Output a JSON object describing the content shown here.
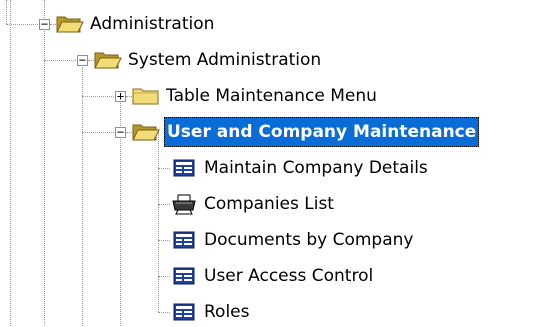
{
  "tree": {
    "nodes": [
      {
        "id": "administration",
        "label": "Administration",
        "depth": 0,
        "icon": "folder-open-icon",
        "expander": "minus",
        "selected": false
      },
      {
        "id": "system-administration",
        "label": "System Administration",
        "depth": 1,
        "icon": "folder-open-icon",
        "expander": "minus",
        "selected": false
      },
      {
        "id": "table-maintenance-menu",
        "label": "Table Maintenance Menu",
        "depth": 2,
        "icon": "folder-closed-icon",
        "expander": "plus",
        "selected": false
      },
      {
        "id": "user-and-company-maintenance",
        "label": "User and Company Maintenance",
        "depth": 2,
        "icon": "folder-open-icon",
        "expander": "minus",
        "selected": true
      },
      {
        "id": "maintain-company-details",
        "label": "Maintain Company Details",
        "depth": 3,
        "icon": "form-icon",
        "expander": "none",
        "selected": false
      },
      {
        "id": "companies-list",
        "label": "Companies List",
        "depth": 3,
        "icon": "printer-icon",
        "expander": "none",
        "selected": false
      },
      {
        "id": "documents-by-company",
        "label": "Documents by Company",
        "depth": 3,
        "icon": "form-icon",
        "expander": "none",
        "selected": false
      },
      {
        "id": "user-access-control",
        "label": "User Access Control",
        "depth": 3,
        "icon": "form-icon",
        "expander": "none",
        "selected": false
      },
      {
        "id": "roles",
        "label": "Roles",
        "depth": 3,
        "icon": "form-icon",
        "expander": "none",
        "selected": false
      }
    ]
  },
  "colors": {
    "selection_background": "#0a6cd6",
    "selection_text": "#ffffff",
    "folder_fill": "#f2dc78",
    "folder_dark": "#b8962e",
    "form_blue": "#1f3f9f",
    "tree_lines": "#9a9a9a"
  }
}
